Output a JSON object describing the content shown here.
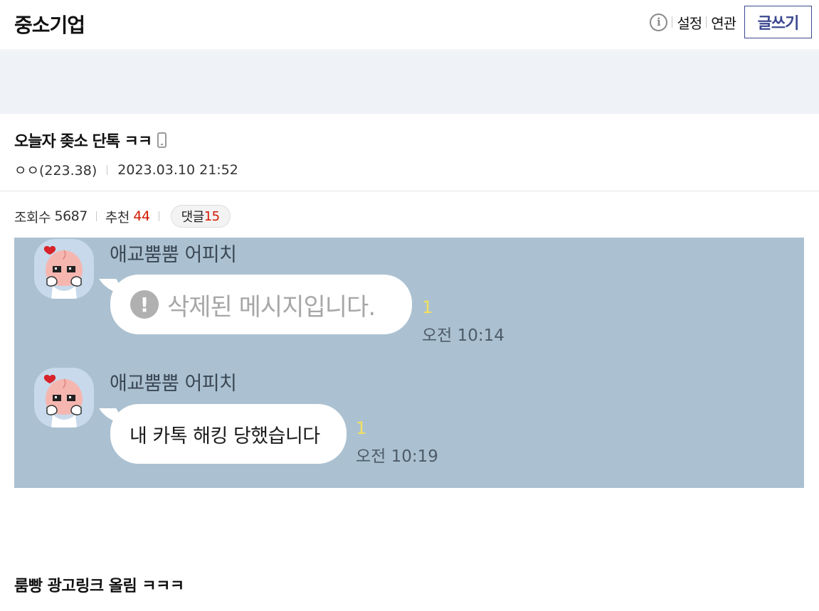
{
  "header": {
    "gallery_title": "중소기업",
    "info_icon_glyph": "i",
    "settings_label": "설정",
    "related_label": "연관",
    "write_label": "글쓰기"
  },
  "post": {
    "title": "오늘자 좆소 단톡 ㅋㅋ",
    "device_icon": "mobile-phone-icon",
    "author": "ㅇㅇ(223.38)",
    "datetime": "2023.03.10 21:52",
    "views_label": "조회수",
    "views": "5687",
    "recommend_label": "추천",
    "recommend": "44",
    "comments_label": "댓글",
    "comments": "15",
    "body_text": "룸빵 광고링크 올림 ㅋㅋㅋ"
  },
  "chat": {
    "background_color": "#abc1d1",
    "messages": [
      {
        "sender": "애교뿜뿜 어피치",
        "text": "삭제된 메시지입니다.",
        "deleted": true,
        "warn_glyph": "!",
        "unread": "1",
        "time": "오전 10:14"
      },
      {
        "sender": "애교뿜뿜 어피치",
        "text": "내 카톡 해킹 당했습니다",
        "deleted": false,
        "unread": "1",
        "time": "오전 10:19"
      }
    ]
  },
  "colors": {
    "accent": "#3b4890",
    "recommend_red": "#d31900",
    "banner_bg": "#eff2f7",
    "unread_yellow": "#f4e05c"
  }
}
